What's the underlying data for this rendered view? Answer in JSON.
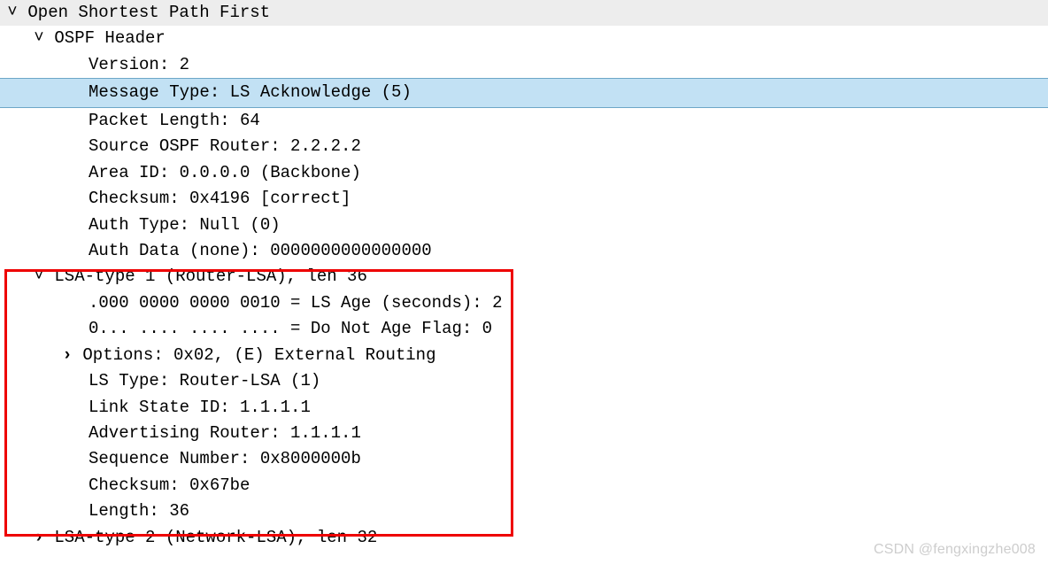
{
  "protocol": {
    "label": "Open Shortest Path First"
  },
  "header": {
    "label": "OSPF Header",
    "version": "Version: 2",
    "msgtype": "Message Type: LS Acknowledge (5)",
    "pktlen": "Packet Length: 64",
    "src": "Source OSPF Router: 2.2.2.2",
    "area": "Area ID: 0.0.0.0 (Backbone)",
    "cksum": "Checksum: 0x4196 [correct]",
    "authtype": "Auth Type: Null (0)",
    "authdata": "Auth Data (none): 0000000000000000"
  },
  "lsa1": {
    "label": "LSA-type 1 (Router-LSA), len 36",
    "age": ".000 0000 0000 0010 = LS Age (seconds): 2",
    "dna": "0... .... .... .... = Do Not Age Flag: 0",
    "options": "Options: 0x02, (E) External Routing",
    "lstype": "LS Type: Router-LSA (1)",
    "lsid": "Link State ID: 1.1.1.1",
    "advrouter": "Advertising Router: 1.1.1.1",
    "seq": "Sequence Number: 0x8000000b",
    "cksum": "Checksum: 0x67be",
    "length": "Length: 36"
  },
  "lsa2": {
    "label": "LSA-type 2 (Network-LSA), len 32"
  },
  "watermark": "CSDN @fengxingzhe008"
}
